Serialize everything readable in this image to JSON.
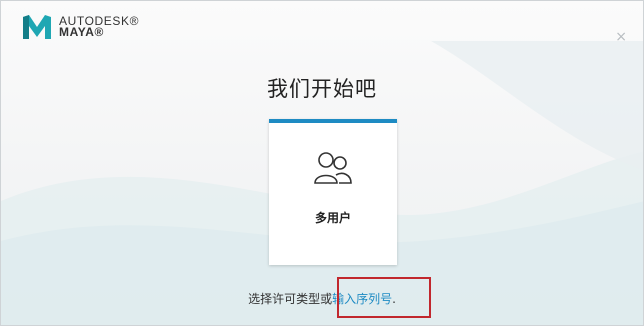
{
  "header": {
    "brand_line1": "AUTODESK®",
    "brand_line2": "MAYA®",
    "close_glyph": "×"
  },
  "main": {
    "title": "我们开始吧",
    "cards": [
      {
        "label": "多用户",
        "icon": "multi-user-icon"
      }
    ]
  },
  "footer": {
    "prefix": "选择许可类型或",
    "link": "输入序列号",
    "suffix": "."
  },
  "colors": {
    "accent": "#1e8bc3",
    "logo_teal": "#1fa7b3",
    "highlight": "#c1272d"
  }
}
